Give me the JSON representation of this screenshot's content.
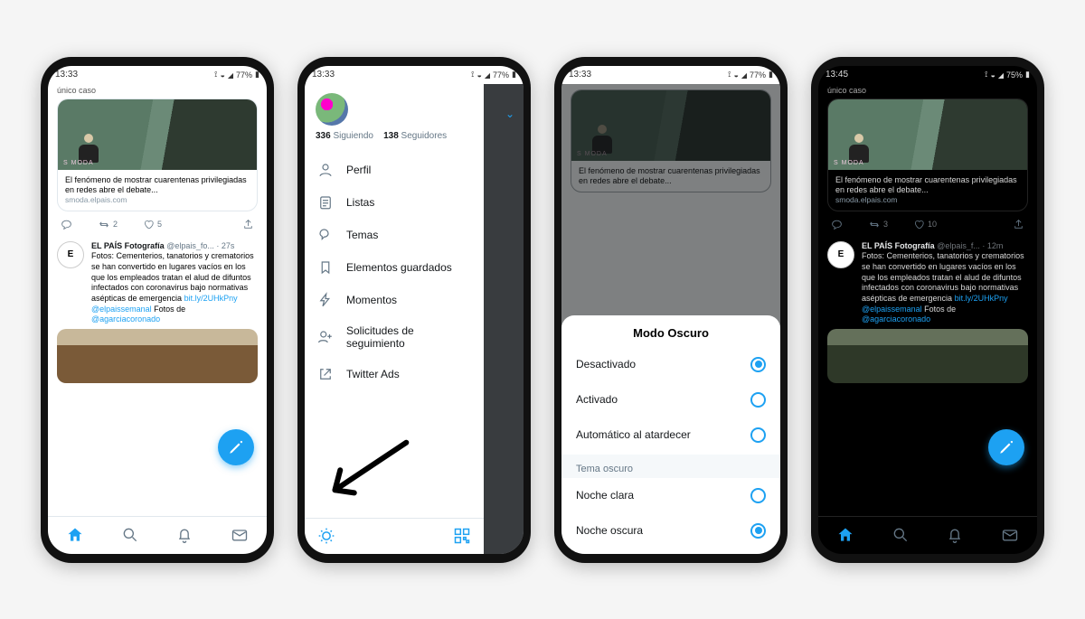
{
  "status": {
    "time_a": "13:33",
    "time_b": "13:45",
    "battery_a": "77%",
    "battery_b": "75%",
    "sim": "⬝"
  },
  "feed": {
    "truncated_top": "único caso",
    "card": {
      "tag": "S MODA",
      "headline": "El fenómeno de mostrar cuarentenas privilegiadas en redes abre el debate...",
      "source": "smoda.elpais.com"
    },
    "actions": {
      "retweet_count": "2",
      "like_count_light": "5",
      "like_count_dark": "10",
      "rt_count_dark": "3"
    },
    "tweet": {
      "avatar_letter": "E",
      "avatar_sub": "Fotografía",
      "author": "EL PAÍS Fotografía",
      "handle_light": "@elpais_fo...",
      "handle_dark": "@elpais_f...",
      "time_light": "27s",
      "time_dark": "12m",
      "body_pre": "Fotos:  Cementerios, tanatorios y crematorios se han convertido en lugares vacíos en los que los empleados tratan el alud de difuntos infectados con coronavirus bajo normativas asépticas de emergencia ",
      "short_link": "bit.ly/2UHkPny",
      "mid": " Fotos de ",
      "mention1": "@elpaissemanal",
      "mention2": "@agarciacoronado"
    }
  },
  "drawer": {
    "following_count": "336",
    "following_label": "Siguiendo",
    "followers_count": "138",
    "followers_label": "Seguidores",
    "items": [
      "Perfil",
      "Listas",
      "Temas",
      "Elementos guardados",
      "Momentos",
      "Solicitudes de seguimiento",
      "Twitter Ads"
    ]
  },
  "sheet": {
    "title": "Modo Oscuro",
    "options": [
      {
        "label": "Desactivado",
        "selected": true
      },
      {
        "label": "Activado",
        "selected": false
      },
      {
        "label": "Automático al atardecer",
        "selected": false
      }
    ],
    "subhead": "Tema oscuro",
    "themes": [
      {
        "label": "Noche clara",
        "selected": false
      },
      {
        "label": "Noche oscura",
        "selected": true
      }
    ]
  }
}
